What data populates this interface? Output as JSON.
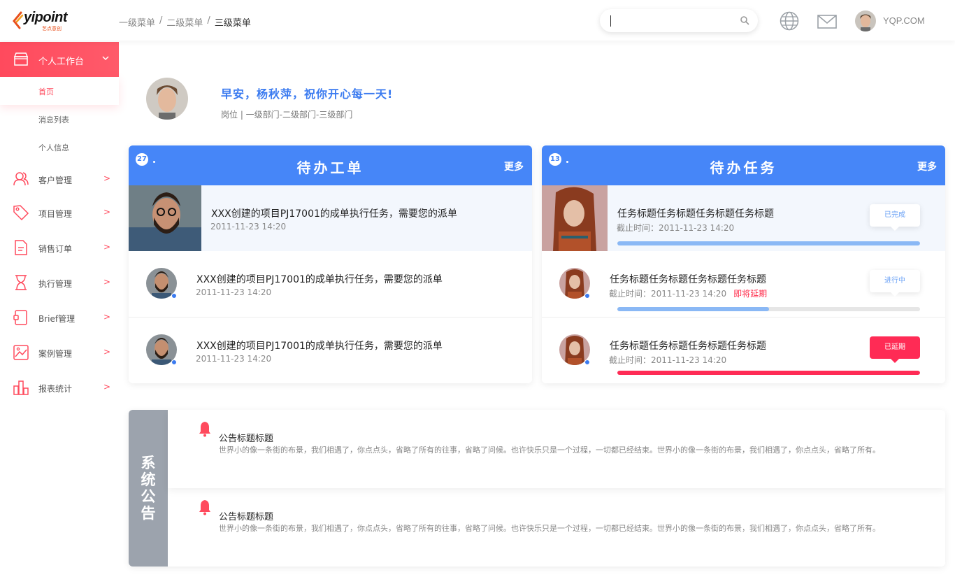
{
  "header": {
    "logo_text": "yipoint",
    "logo_sub": "艺点意创",
    "breadcrumb": [
      "一级菜单",
      "二级菜单",
      "三级菜单"
    ],
    "breadcrumb_sep": "/",
    "search_value": "",
    "username": "YQP.COM"
  },
  "sidebar": {
    "active_group": "个人工作台",
    "sub_items": [
      "首页",
      "消息列表",
      "个人信息"
    ],
    "items": [
      {
        "label": "客户管理",
        "icon": "users-icon"
      },
      {
        "label": "项目管理",
        "icon": "tag-icon"
      },
      {
        "label": "销售订单",
        "icon": "document-icon"
      },
      {
        "label": "执行管理",
        "icon": "hourglass-icon"
      },
      {
        "label": "Brief管理",
        "icon": "wallet-icon"
      },
      {
        "label": "案例管理",
        "icon": "image-icon"
      },
      {
        "label": "报表统计",
        "icon": "bar-chart-icon"
      }
    ],
    "arrow": ">"
  },
  "profile": {
    "greeting": "早安，杨秋萍，祝你开心每一天!",
    "dept": "岗位  |  一级部门-二级部门-三级部门"
  },
  "orders": {
    "badge": "27",
    "title": "待办工单",
    "more": "更多",
    "rows": [
      {
        "text": "XXX创建的项目PJ17001的成单执行任务，需要您的派单",
        "time": "2011-11-23 14:20"
      },
      {
        "text": "XXX创建的项目PJ17001的成单执行任务，需要您的派单",
        "time": "2011-11-23 14:20"
      },
      {
        "text": "XXX创建的项目PJ17001的成单执行任务，需要您的派单",
        "time": "2011-11-23 14:20"
      }
    ]
  },
  "tasks": {
    "badge": "13",
    "title": "待办任务",
    "more": "更多",
    "rows": [
      {
        "text": "任务标题任务标题任务标题任务标题",
        "time": "截止时间：2011-11-23 14:20",
        "warn": "",
        "status": "已完成",
        "progress": 1.0,
        "color": "#8ab8f5"
      },
      {
        "text": "任务标题任务标题任务标题任务标题",
        "time": "截止时间：2011-11-23 14:20",
        "warn": "即将延期",
        "status": "进行中",
        "progress": 0.5,
        "color": "#8ab8f5"
      },
      {
        "text": "任务标题任务标题任务标题任务标题",
        "time": "截止时间：2011-11-23 14:20",
        "warn": "",
        "status": "已延期",
        "progress": 1.0,
        "color": "#ff2b55"
      }
    ]
  },
  "notices": {
    "side_title": [
      "系",
      "统",
      "公",
      "告"
    ],
    "items": [
      {
        "title": "公告标题标题",
        "body": "世界小的像一条街的布景，我们相遇了，你点点头，省略了所有的往事，省略了问候。也许快乐只是一个过程，一切都已经结束。世界小的像一条街的布景，我们相遇了，你点点头，省略了所有。"
      },
      {
        "title": "公告标题标题",
        "body": "世界小的像一条街的布景，我们相遇了，你点点头，省略了所有的往事，省略了问候。也许快乐只是一个过程，一切都已经结束。世界小的像一条街的布景，我们相遇了，你点点头，省略了所有。"
      }
    ]
  },
  "colors": {
    "accent": "#4686f8",
    "brand_red": "#ff4a5d",
    "late": "#ff2b55"
  }
}
